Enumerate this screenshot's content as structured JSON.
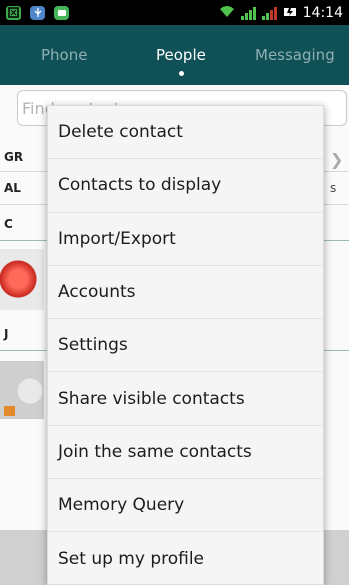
{
  "status_bar": {
    "time": "14:14",
    "icons": [
      "screenshot-icon",
      "usb-icon",
      "message-icon",
      "wifi-icon",
      "signal-icon",
      "signal-icon",
      "battery-charging-icon"
    ]
  },
  "tabs": [
    {
      "label": "Phone",
      "active": false
    },
    {
      "label": "People",
      "active": true
    },
    {
      "label": "Messaging",
      "active": false
    }
  ],
  "search": {
    "placeholder": "Find contacts"
  },
  "list": {
    "groups_label": "GR",
    "all_label": "AL",
    "all_suffix": "s",
    "section_c": "C",
    "section_j": "J"
  },
  "menu": {
    "items": [
      "Delete contact",
      "Contacts to display",
      "Import/Export",
      "Accounts",
      "Settings",
      "Share visible contacts",
      "Join the same contacts",
      "Memory Query",
      "Set up my profile"
    ]
  },
  "colors": {
    "tab_bar": "#0f5157",
    "status_bar": "#000000",
    "menu_bg": "#f5f5f5"
  }
}
